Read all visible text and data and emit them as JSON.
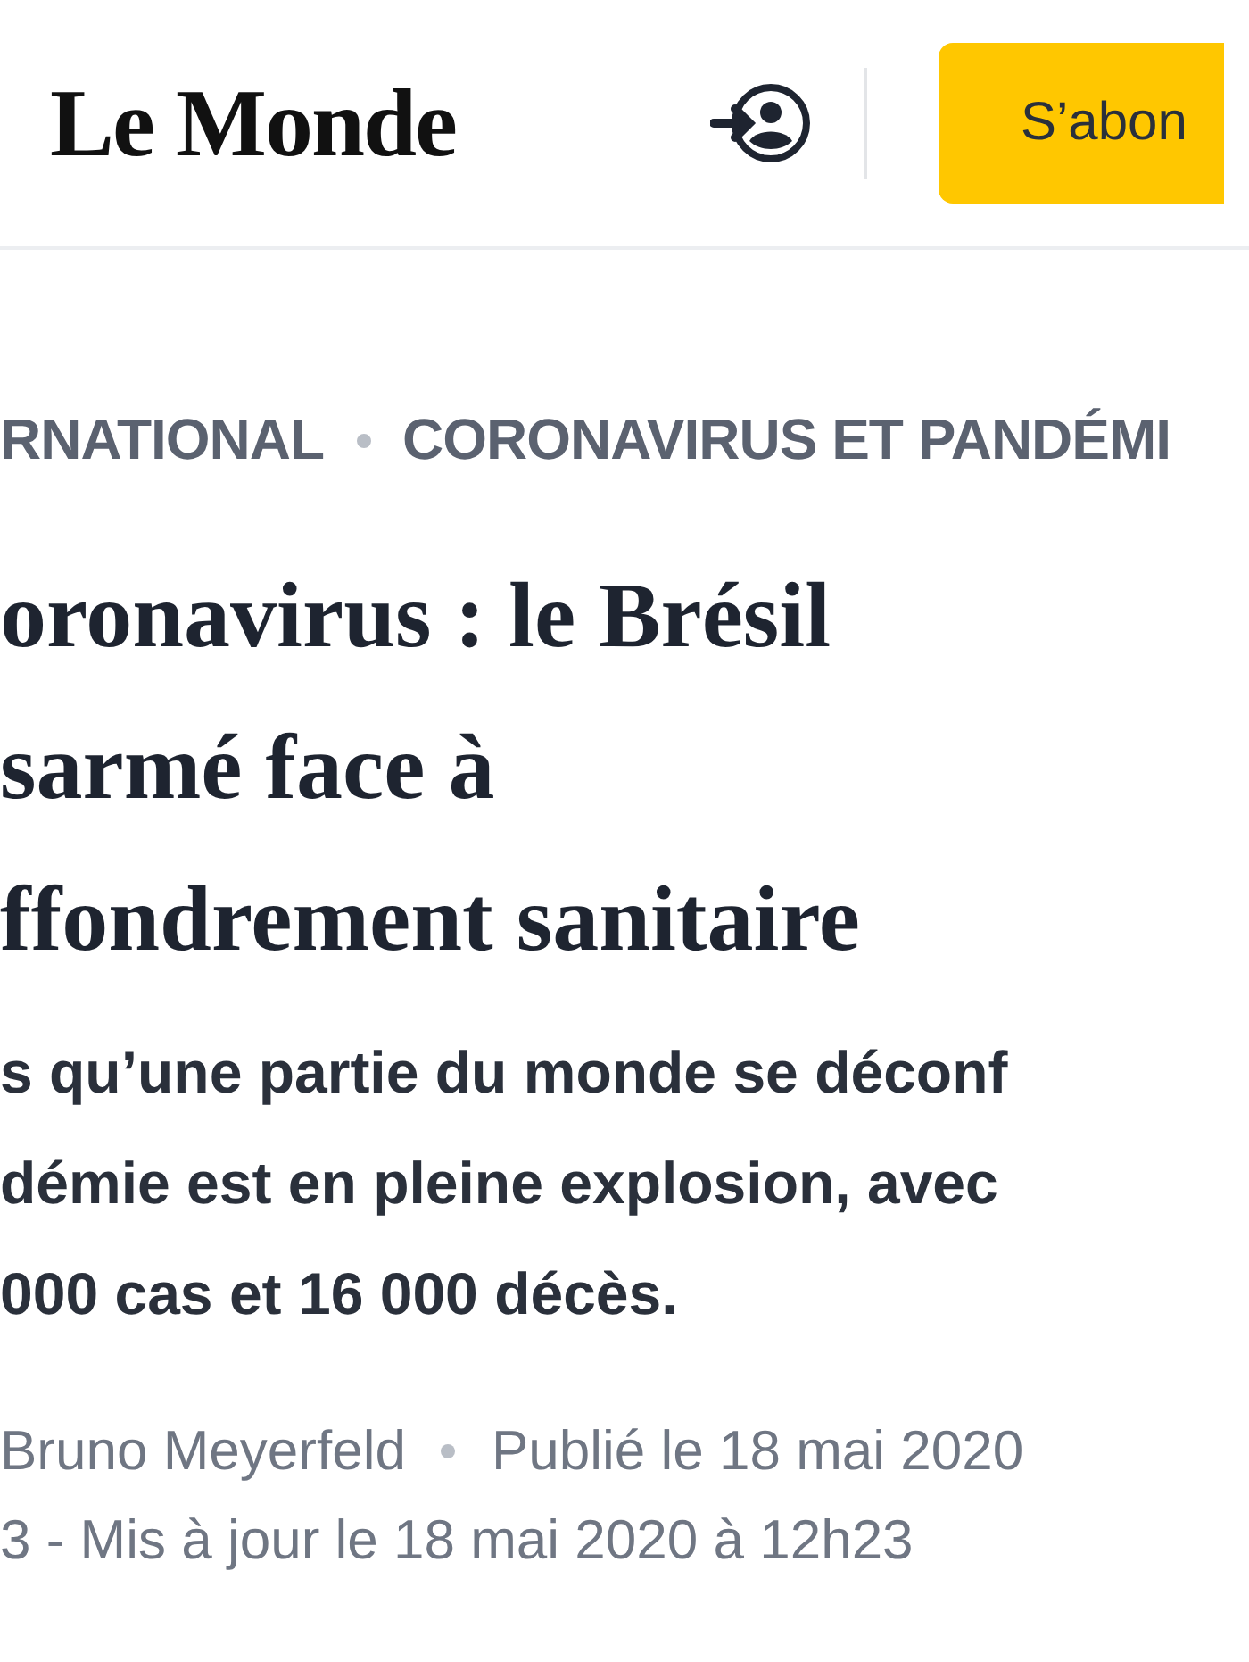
{
  "header": {
    "logo": "Le Monde",
    "subscribe_button": "S’abon"
  },
  "breadcrumb": [
    "RNATIONAL",
    "CORONAVIRUS ET PANDÉMI"
  ],
  "headline_lines": [
    "oronavirus : le Brésil",
    "sarmé face à",
    "ffondrement sanitaire"
  ],
  "lede_lines": [
    "s qu’une partie du monde se déconf",
    "démie est en pleine explosion, avec",
    "000 cas et 16 000 décès."
  ],
  "byline": {
    "author": "Bruno Meyerfeld",
    "published": "Publié le 18 mai 2020",
    "updated": "3 - Mis à jour le 18 mai 2020 à 12h23"
  }
}
